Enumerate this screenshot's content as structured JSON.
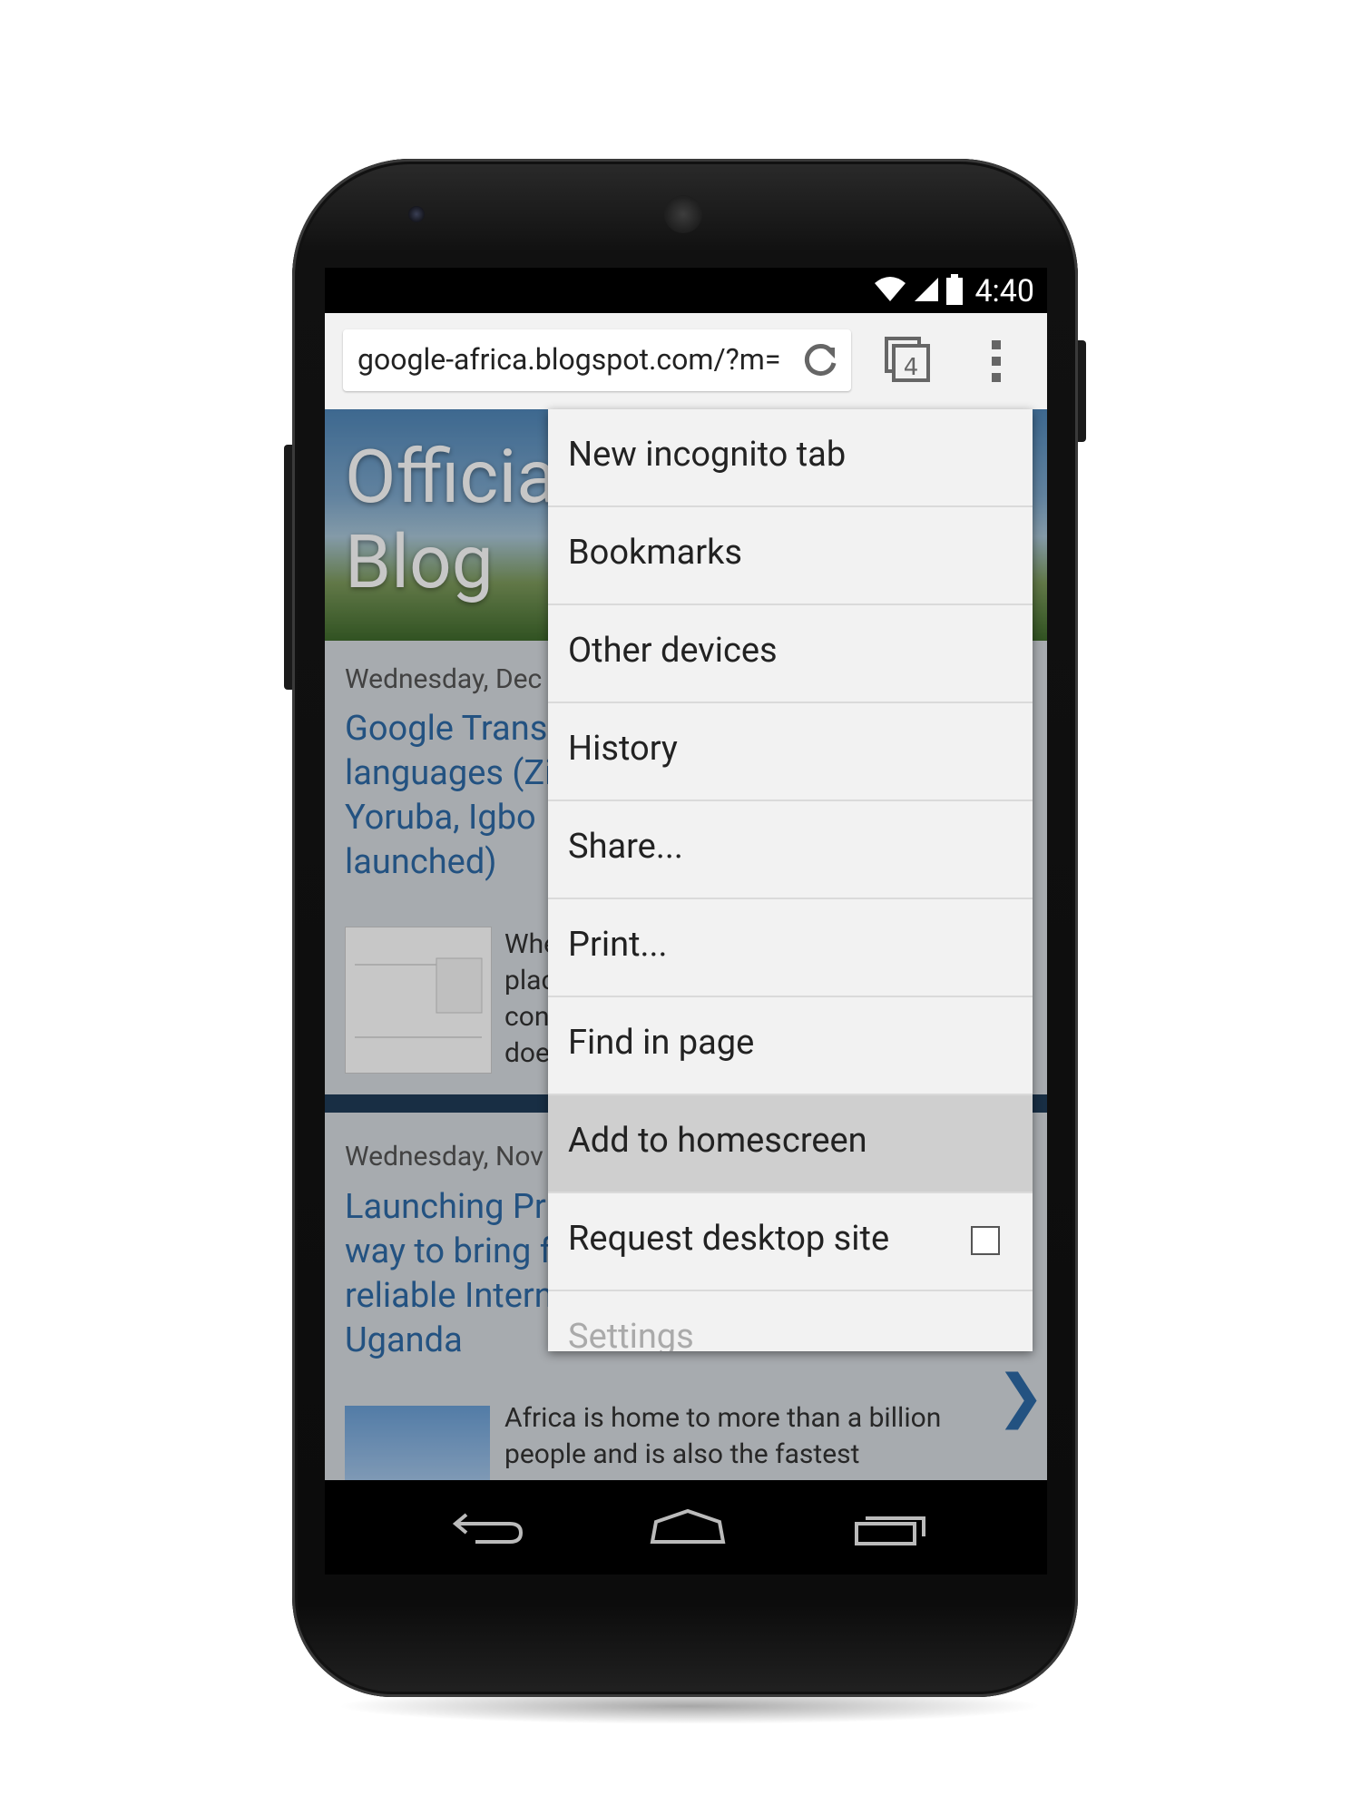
{
  "status_bar": {
    "time": "4:40"
  },
  "toolbar": {
    "url": "google-africa.blogspot.com/?m=",
    "tab_count": "4"
  },
  "page": {
    "blog_title_line1": "Officia",
    "blog_title_line2": "Blog",
    "post1": {
      "date": "Wednesday, Dec",
      "title_lines": [
        "Google Trans",
        "languages (Zi",
        "Yoruba, Igbo",
        "launched)"
      ],
      "excerpt_lines": [
        "Whe",
        "plac",
        "con",
        "doe"
      ]
    },
    "post2": {
      "date": "Wednesday, Nov",
      "title_lines": [
        "Launching Pr",
        "way to bring f",
        "reliable Intern",
        "Uganda"
      ],
      "excerpt_lines": [
        "Africa is home to more than a billion",
        "people and is also the fastest"
      ]
    }
  },
  "menu": {
    "items": [
      {
        "label": "New incognito tab"
      },
      {
        "label": "Bookmarks"
      },
      {
        "label": "Other devices"
      },
      {
        "label": "History"
      },
      {
        "label": "Share..."
      },
      {
        "label": "Print..."
      },
      {
        "label": "Find in page"
      },
      {
        "label": "Add to homescreen",
        "selected": true
      },
      {
        "label": "Request desktop site",
        "checkbox": false
      },
      {
        "label": "Settings"
      }
    ]
  },
  "colors": {
    "link": "#2d6aa6",
    "menu_bg": "#f2f2f2",
    "menu_selected": "#cfcfcf"
  }
}
